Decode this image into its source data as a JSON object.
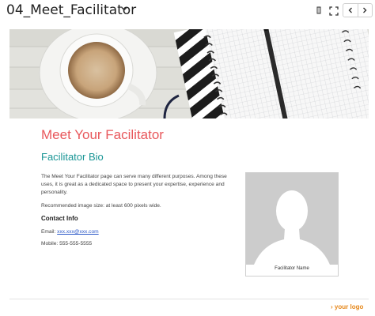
{
  "toolbar": {
    "title": "04_Meet_Facilitator",
    "icons": [
      "chevron-down-icon",
      "bookmark-icon",
      "expand-icon",
      "chevron-left-icon",
      "chevron-right-icon"
    ]
  },
  "content": {
    "heading": "Meet Your Facilitator",
    "subheading": "Facilitator Bio",
    "paragraph_1": "The Meet Your Facilitator page can serve many different purposes. Among these uses, it is great as a dedicated space to present your expertise, experience and personality.",
    "paragraph_2": "Recommended image size: at least 600 pixels wide.",
    "contact_heading": "Contact Info",
    "email_label": "Email: ",
    "email_value": "xxx.xxx@xxx.com",
    "mobile": "Mobile: 555-555-5555",
    "photo_caption": "Facilitator Name"
  },
  "footer": {
    "logo_text": "your logo"
  },
  "colors": {
    "heading": "#e8585c",
    "subheading": "#1a9696",
    "link": "#2b58c8",
    "logo": "#e6871a",
    "photo_placeholder": "#cccccc"
  }
}
